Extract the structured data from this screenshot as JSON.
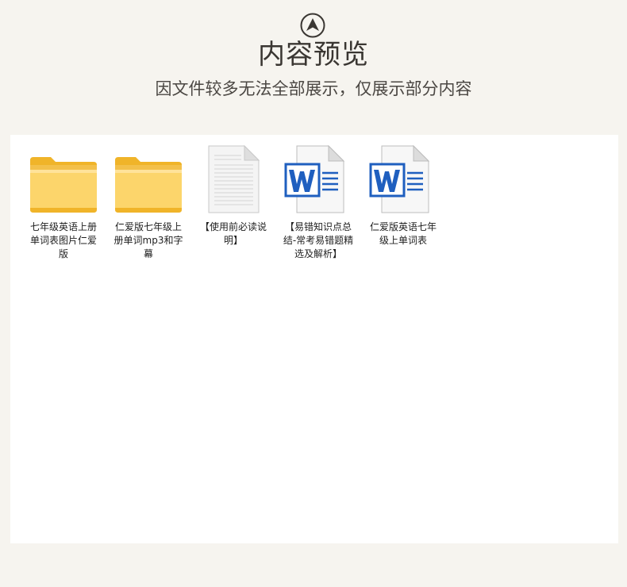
{
  "header": {
    "title": "内容预览",
    "subtitle": "因文件较多无法全部展示，仅展示部分内容"
  },
  "files": [
    {
      "type": "folder",
      "icon": "folder-icon",
      "name": "七年级英语上册单词表图片仁爱版"
    },
    {
      "type": "folder",
      "icon": "folder-icon",
      "name": "仁爱版七年级上册单词mp3和字幕"
    },
    {
      "type": "text",
      "icon": "text-document-icon",
      "name": "【使用前必读说明】"
    },
    {
      "type": "word",
      "icon": "word-document-icon",
      "name": "【易错知识点总结-常考易错题精选及解析】"
    },
    {
      "type": "word",
      "icon": "word-document-icon",
      "name": "仁爱版英语七年级上单词表"
    }
  ],
  "colors": {
    "background": "#f6f4ef",
    "panel": "#ffffff",
    "folder": "#f6c342",
    "word_blue": "#1f5fbf"
  }
}
